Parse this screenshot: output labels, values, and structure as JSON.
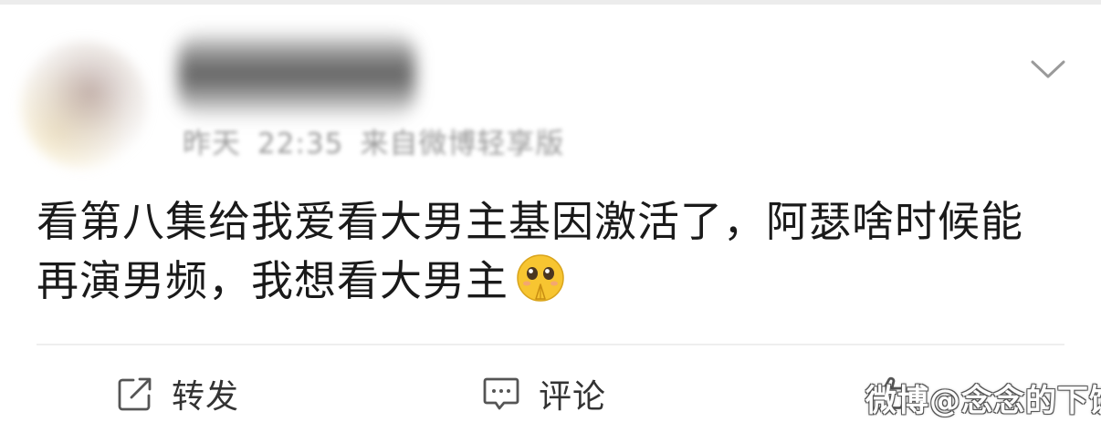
{
  "post": {
    "meta": {
      "time_day": "昨天",
      "time_clock": "22:35",
      "source": "来自微博轻享版"
    },
    "text_line1": "看第八集给我爱看大男主基因激活了，阿瑟啥时候能",
    "text_line2": "再演男频，我想看大男主",
    "emoji": "pleading-praying-emoji"
  },
  "actions": {
    "repost_label": "转发",
    "comment_label": "评论",
    "like_icon": "thumbs-up-icon"
  },
  "watermark": {
    "text": "微博@念念的下饭剧"
  },
  "colors": {
    "text": "#1a1a1a",
    "meta": "#9a9a9a",
    "divider": "#eeeeee",
    "emoji_face": "#f7c531"
  }
}
